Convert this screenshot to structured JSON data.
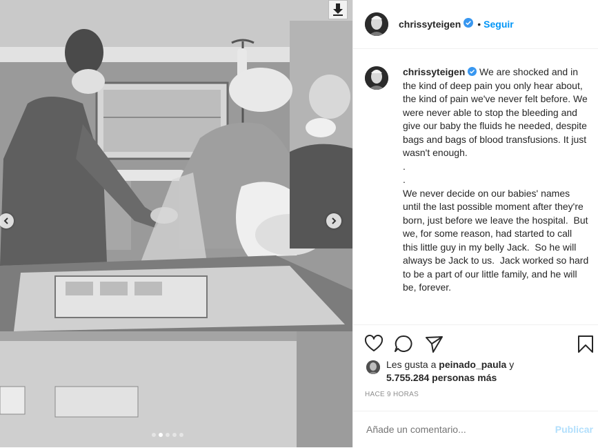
{
  "post": {
    "username": "chrissyteigen",
    "separator": "•",
    "follow_label": "Seguir",
    "caption_paragraphs": [
      "We are shocked and in the kind of deep pain you only hear about, the kind of pain we've never felt before. We were never able to stop the bleeding and give our baby the fluids he needed, despite bags and bags of blood transfusions. It just wasn't enough.",
      ".",
      ".",
      "We never decide on our babies' names until the last possible moment after they're born, just before we leave the hospital.  But we, for some reason, had started to call this little guy in my belly Jack.  So he will always be Jack to us.  Jack worked so hard to be a part of our little family, and he will be, forever."
    ],
    "likes_prefix": "Les gusta a",
    "liked_by": "peinado_paula",
    "likes_joiner": "y",
    "likes_count_text": "5.755.284 personas más",
    "timestamp": "HACE 9 HORAS",
    "comment_placeholder": "Añade un comentario...",
    "publish_label": "Publicar"
  },
  "carousel": {
    "slides": 5,
    "active_index": 1
  },
  "icons": {
    "verified": "verified-badge-icon",
    "like": "heart-icon",
    "comment": "comment-icon",
    "share": "paper-plane-icon",
    "save": "bookmark-icon",
    "download": "download-arrow-icon",
    "prev": "chevron-left-icon",
    "next": "chevron-right-icon"
  },
  "colors": {
    "link_blue": "#0095f6",
    "verified_blue": "#3897f0",
    "muted_gray": "#8e8e8e",
    "publish_disabled": "#b2dffc",
    "text": "#262626"
  }
}
